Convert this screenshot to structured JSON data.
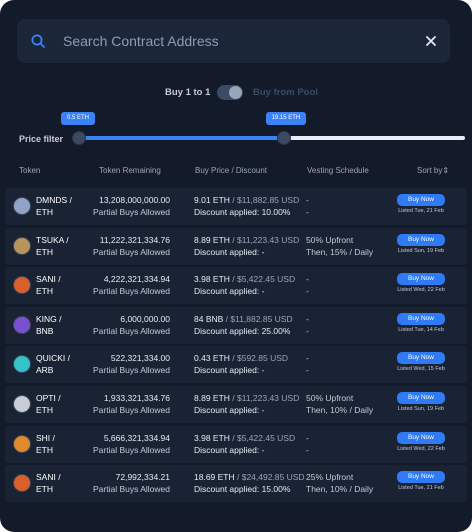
{
  "search": {
    "placeholder": "Search Contract Address"
  },
  "toggle": {
    "left_label": "Buy 1 to 1",
    "right_label": "Buy from Pool"
  },
  "filter": {
    "label": "Price filter",
    "min_label": "0.5 ETH",
    "max_label": "19.15 ETH",
    "range_start_fraction": 0.0,
    "range_end_fraction": 0.53
  },
  "columns": [
    "Token",
    "Token Remaining",
    "Buy Price / Discount",
    "Vesting Schedule",
    "Sort by"
  ],
  "rows": [
    {
      "token": "DMNDS /",
      "chain": "ETH",
      "remaining": "13,208,000,000.00",
      "partial": "Partial Buys Allowed",
      "price": "9.01 ETH",
      "usd": " / $11,882.85 USD",
      "discount": "Discount applied: 10.00%",
      "vest1": "-",
      "vest2": "-",
      "buy": "Buy Now",
      "listed": "Listed Tue, 21 Feb",
      "icon": "diamond-token-icon",
      "icon_color": "#8fa3c7"
    },
    {
      "token": "TSUKA /",
      "chain": "ETH",
      "remaining": "11,222,321,334.76",
      "partial": "Partial Buys Allowed",
      "price": "8.89 ETH",
      "usd": " / $11,223.43 USD",
      "discount": "Discount applied: -",
      "vest1": "50% Upfront",
      "vest2": "Then, 15% / Daily",
      "buy": "Buy Now",
      "listed": "Listed Sun, 19 Feb",
      "icon": "dragon-token-icon",
      "icon_color": "#b8955a"
    },
    {
      "token": "SANI /",
      "chain": "ETH",
      "remaining": "4,222,321,334.94",
      "partial": "Partial Buys Allowed",
      "price": "3.98 ETH",
      "usd": " / $5,422.45 USD",
      "discount": "Discount applied: -",
      "vest1": "-",
      "vest2": "-",
      "buy": "Buy Now",
      "listed": "Listed Wed, 22 Feb",
      "icon": "shiba-token-icon",
      "icon_color": "#d9602b"
    },
    {
      "token": "KING /",
      "chain": "BNB",
      "remaining": "6,000,000.00",
      "partial": "Partial Buys Allowed",
      "price": "84 BNB",
      "usd": " / $11,882.85 USD",
      "discount": "Discount applied: 25.00%",
      "vest1": "-",
      "vest2": "-",
      "buy": "Buy Now",
      "listed": "Listed Tue, 14 Feb",
      "icon": "crown-token-icon",
      "icon_color": "#7b4fd1"
    },
    {
      "token": "QUICKI /",
      "chain": "ARB",
      "remaining": "522,321,334.00",
      "partial": "Partial Buys Allowed",
      "price": "0.43 ETH",
      "usd": " / $592.85 USD",
      "discount": "Discount applied: -",
      "vest1": "-",
      "vest2": "-",
      "buy": "Buy Now",
      "listed": "Listed Wed, 15 Feb",
      "icon": "quick-token-icon",
      "icon_color": "#35c2c9"
    },
    {
      "token": "OPTI /",
      "chain": "ETH",
      "remaining": "1,933,321,334.76",
      "partial": "Partial Buys Allowed",
      "price": "8.89 ETH",
      "usd": " / $11,223.43 USD",
      "discount": "Discount applied: -",
      "vest1": "50% Upfront",
      "vest2": "Then, 10% / Daily",
      "buy": "Buy Now",
      "listed": "Listed Sun, 19 Feb",
      "icon": "opti-token-icon",
      "icon_color": "#c7ccd6"
    },
    {
      "token": "SHI /",
      "chain": "ETH",
      "remaining": "5,666,321,334.94",
      "partial": "Partial Buys Allowed",
      "price": "3.98 ETH",
      "usd": " / $5,422.45 USD",
      "discount": "Discount applied: -",
      "vest1": "-",
      "vest2": "-",
      "buy": "Buy Now",
      "listed": "Listed Wed, 22 Feb",
      "icon": "shib-token-icon",
      "icon_color": "#e08a2e"
    },
    {
      "token": "SANI /",
      "chain": "ETH",
      "remaining": "72,992,334.21",
      "partial": "Partial Buys Allowed",
      "price": "18.69 ETH",
      "usd": " / $24,492.85 USD",
      "discount": "Discount applied: 15.00%",
      "vest1": "25% Upfront",
      "vest2": "Then, 10% / Daily",
      "buy": "Buy Now",
      "listed": "Listed Tue, 21 Feb",
      "icon": "shiba-token-icon",
      "icon_color": "#d9602b"
    }
  ]
}
